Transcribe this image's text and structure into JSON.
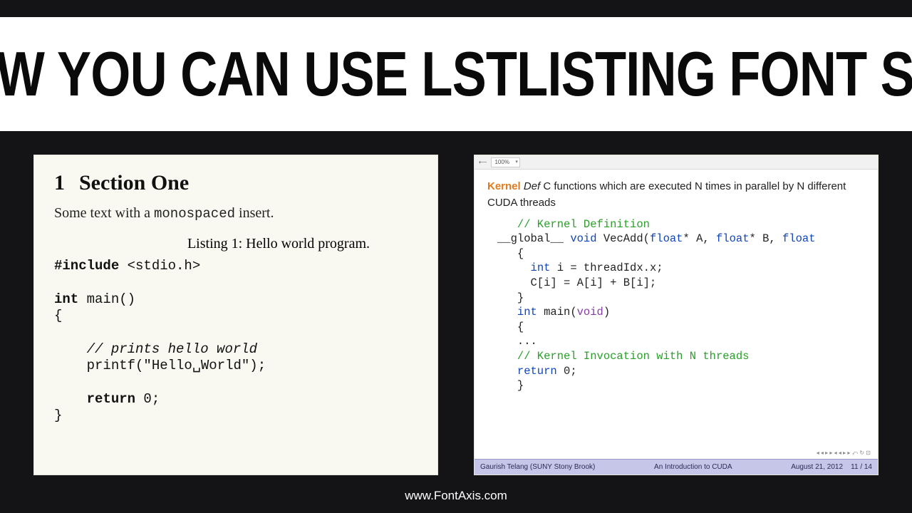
{
  "title": "HOW YOU CAN USE LSTLISTING FONT SIZE",
  "footer_url": "www.FontAxis.com",
  "left": {
    "section_num": "1",
    "section_title": "Section One",
    "body_pre": "Some text with a ",
    "body_mono": "monospaced",
    "body_post": " insert.",
    "listing_caption": "Listing 1: Hello world program.",
    "code": {
      "l1a": "#include",
      "l1b": " <stdio.h>",
      "l2": "",
      "l3a": "int",
      "l3b": " main()",
      "l4": "{",
      "l5": "",
      "l6": "    // prints hello world",
      "l7": "    printf(\"Hello␣World\");",
      "l8": "",
      "l9a": "    return",
      "l9b": " 0;",
      "l10": "}"
    }
  },
  "right": {
    "arrow": "⟵",
    "zoom": "100%",
    "def_kernel": "Kernel",
    "def_def": "Def",
    "def_text": " C functions which are executed N times in parallel by N different CUDA threads",
    "code": {
      "c1": "   // Kernel Definition",
      "c2a": "__global__ ",
      "c2b": "void",
      "c2c": " VecAdd(",
      "c2d": "float",
      "c2e": "* A, ",
      "c2f": "float",
      "c2g": "* B, ",
      "c2h": "float",
      "c3": "   {",
      "c4a": "     ",
      "c4b": "int",
      "c4c": " i = threadIdx.x;",
      "c5": "     C[i] = A[i] + B[i];",
      "c6": "   }",
      "c7a": "   ",
      "c7b": "int",
      "c7c": " main(",
      "c7d": "void",
      "c7e": ")",
      "c8": "   {",
      "c9": "   ...",
      "c10": "   // Kernel Invocation with N threads",
      "c11a": "   ",
      "c11b": "return",
      "c11c": " 0;",
      "c12": "   }"
    },
    "nav_glyphs": "◂ ◂ ▸ ▸  ◂ ◂ ▸ ▸  ⤺ ↻ ⊡",
    "foot_author": "Gaurish Telang  (SUNY Stony Brook)",
    "foot_title": "An Introduction to CUDA",
    "foot_date": "August 21, 2012",
    "foot_page": "11 / 14"
  }
}
